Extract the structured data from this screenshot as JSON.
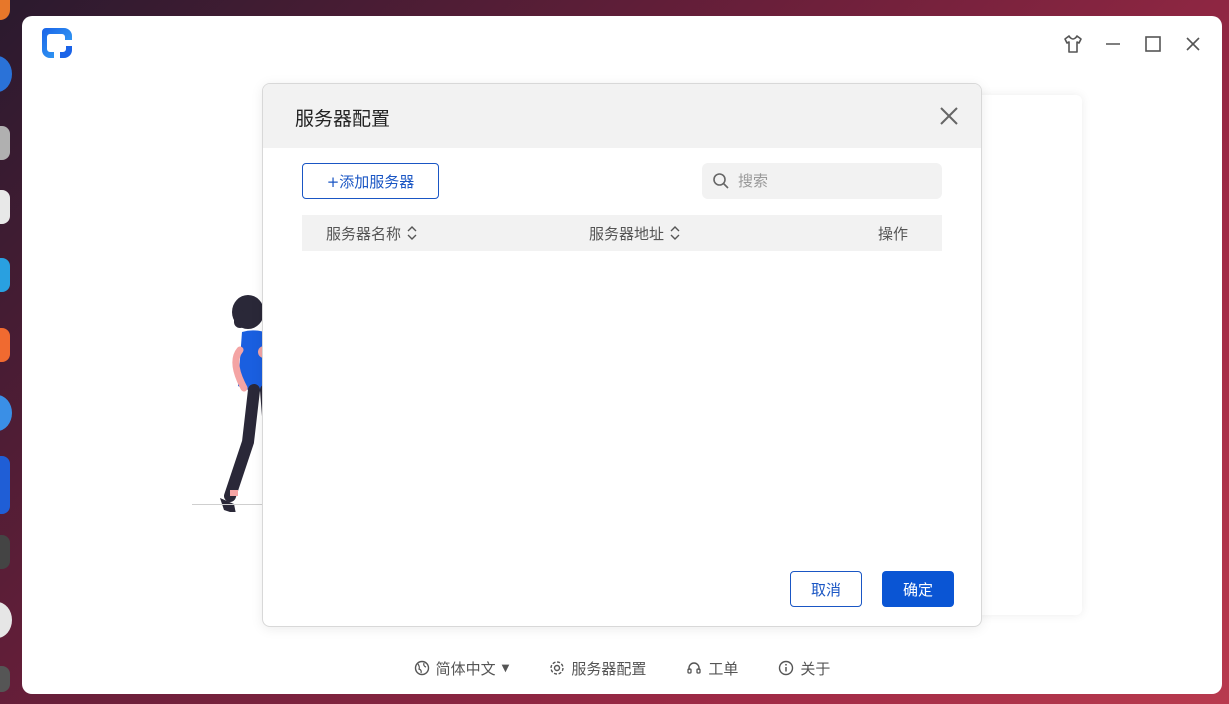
{
  "dialog": {
    "title": "服务器配置",
    "add_button": "+添加服务器",
    "search_placeholder": "搜索",
    "table": {
      "columns": [
        "服务器名称",
        "服务器地址",
        "操作"
      ],
      "rows": []
    },
    "cancel_button": "取消",
    "confirm_button": "确定"
  },
  "footer": {
    "language": "简体中文",
    "server_config": "服务器配置",
    "ticket": "工单",
    "about": "关于"
  },
  "colors": {
    "accent": "#1a56c4",
    "primary": "#0a55d4"
  }
}
